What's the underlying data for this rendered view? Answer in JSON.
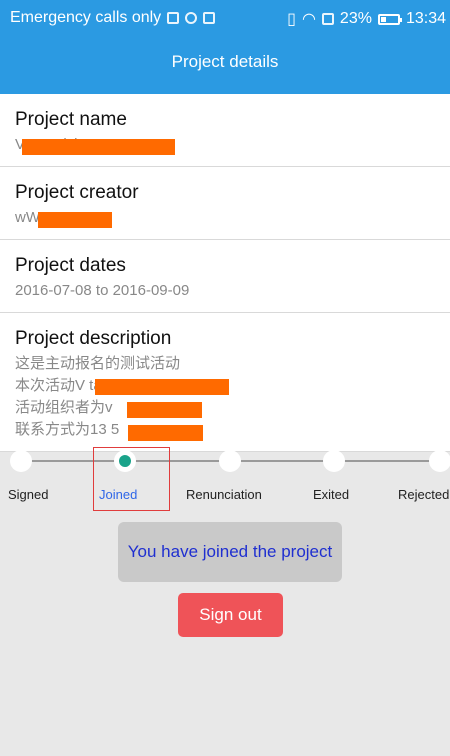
{
  "status_bar": {
    "carrier_text": "Emergency calls only",
    "battery": "23%",
    "time": "13:34"
  },
  "app_bar": {
    "title": "Project details"
  },
  "details": [
    {
      "label": "Project name",
      "value": "V                                  taActivity"
    },
    {
      "label": "Project creator",
      "value": "wW"
    },
    {
      "label": "Project dates",
      "value": "2016-07-08 to 2016-09-09"
    },
    {
      "label": "Project description",
      "value": "这是主动报名的测试活动\n本次活动V                                  taActivity\n活动组织者为v\n联系方式为13             5"
    }
  ],
  "stepper": {
    "steps": [
      "Signed",
      "Joined",
      "Renunciation",
      "Exited",
      "Rejected"
    ],
    "active_step": "Joined"
  },
  "status_message": "You have joined the project",
  "sign_out_label": "Sign out"
}
